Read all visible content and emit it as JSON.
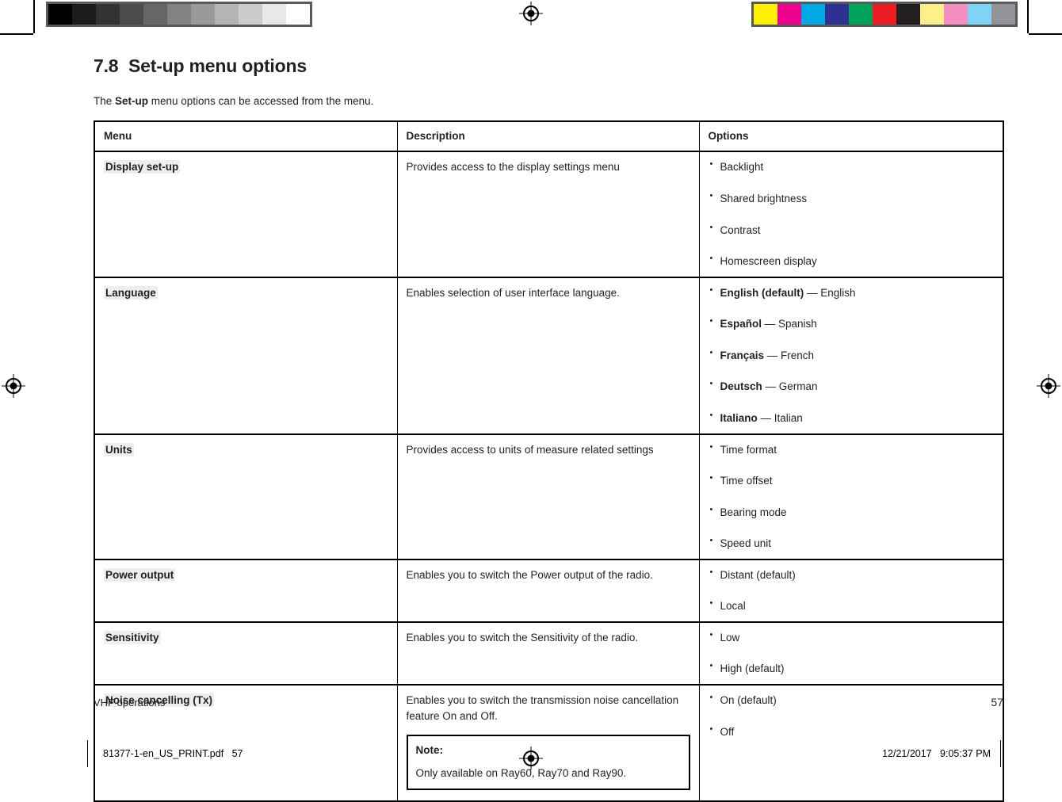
{
  "print_marks": {
    "gray_strip_label": "grayscale-calibration-strip",
    "gray_patches": [
      "#000000",
      "#1b1b1b",
      "#333333",
      "#4b4b4b",
      "#666666",
      "#828282",
      "#9a9a9a",
      "#b4b4b4",
      "#cccccc",
      "#e8e8e8",
      "#ffffff"
    ],
    "color_strip_label": "color-calibration-strip",
    "color_patches": [
      "#fff200",
      "#ec008c",
      "#00a9e4",
      "#2e3192",
      "#00a259",
      "#ed1c24",
      "#231f20",
      "#fdf08a",
      "#f58fc2",
      "#7fd4f5",
      "#929497"
    ],
    "strip_background": "#58595b",
    "registration_mark": "registration-target"
  },
  "section": {
    "number": "7.8",
    "title": "Set-up menu options",
    "intro_prefix": "The ",
    "intro_bold": "Set-up",
    "intro_suffix": " menu options can be accessed from the menu."
  },
  "table": {
    "headers": [
      "Menu",
      "Description",
      "Options"
    ],
    "rows": [
      {
        "menu": "Display set-up",
        "description": "Provides access to the display settings menu",
        "options": [
          {
            "bold": "",
            "rest": "Backlight"
          },
          {
            "bold": "",
            "rest": "Shared brightness"
          },
          {
            "bold": "",
            "rest": "Contrast"
          },
          {
            "bold": "",
            "rest": "Homescreen display"
          }
        ]
      },
      {
        "menu": "Language",
        "description": "Enables selection of user interface language.",
        "options": [
          {
            "bold": "English (default)",
            "rest": " — English"
          },
          {
            "bold": "Español",
            "rest": " — Spanish"
          },
          {
            "bold": "Français",
            "rest": " — French"
          },
          {
            "bold": "Deutsch",
            "rest": " — German"
          },
          {
            "bold": "Italiano",
            "rest": " — Italian"
          }
        ]
      },
      {
        "menu": "Units",
        "description": "Provides access to units of measure related settings",
        "options": [
          {
            "bold": "",
            "rest": "Time format"
          },
          {
            "bold": "",
            "rest": "Time offset"
          },
          {
            "bold": "",
            "rest": "Bearing mode"
          },
          {
            "bold": "",
            "rest": "Speed unit"
          }
        ]
      },
      {
        "menu": "Power output",
        "description": "Enables you to switch the Power output of the radio.",
        "options": [
          {
            "bold": "",
            "rest": "Distant (default)"
          },
          {
            "bold": "",
            "rest": "Local"
          }
        ]
      },
      {
        "menu": "Sensitivity",
        "description": "Enables you to switch the Sensitivity of the radio.",
        "options": [
          {
            "bold": "",
            "rest": "Low"
          },
          {
            "bold": "",
            "rest": "High (default)"
          }
        ]
      },
      {
        "menu": "Noise cancelling (Tx)",
        "description": "Enables you to switch the transmission noise cancellation feature On and Off.",
        "note_title": "Note:",
        "note_body": "Only available on Ray60, Ray70 and Ray90.",
        "options": [
          {
            "bold": "",
            "rest": "On (default)"
          },
          {
            "bold": "",
            "rest": "Off"
          }
        ]
      }
    ]
  },
  "page_footer": {
    "chapter": "VHF operations",
    "page_number": "57"
  },
  "viewer_footer": {
    "filename": "81377-1-en_US_PRINT.pdf   57",
    "timestamp": "12/21/2017   9:05:37 PM"
  }
}
